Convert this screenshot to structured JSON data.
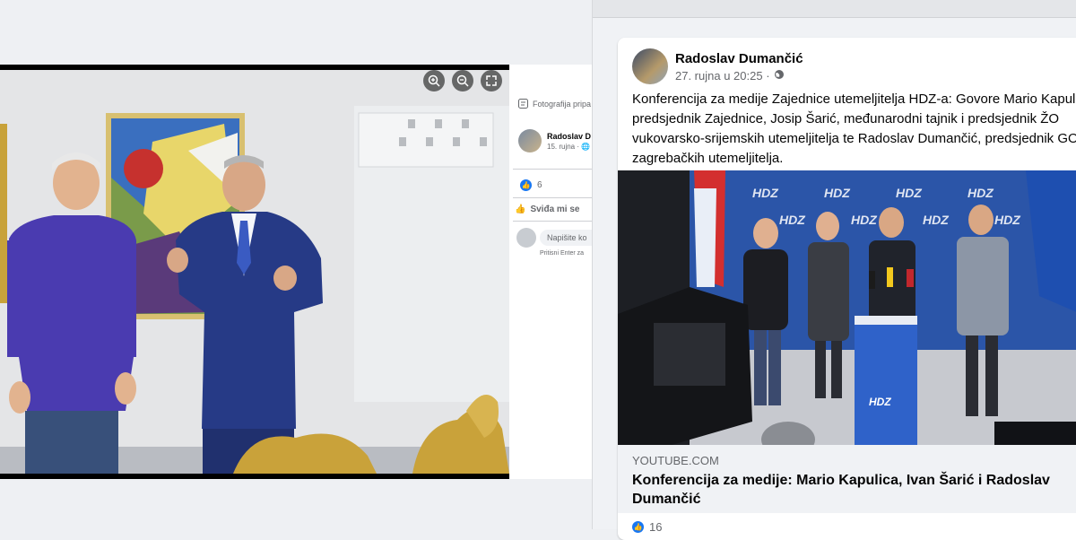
{
  "viewer": {
    "zoom_in_icon": "zoom-in-icon",
    "zoom_out_icon": "zoom-out-icon",
    "fullscreen_icon": "expand-icon"
  },
  "side_panel": {
    "caption": "Fotografija pripa",
    "author": "Radoslav D",
    "date": "15. rujna · ",
    "likes": "6",
    "like_action": "Sviđa mi se",
    "comment_placeholder": "Napišite ko",
    "comment_hint": "Pritisni Enter za"
  },
  "post": {
    "author": "Radoslav Dumančić",
    "date": "27. rujna u 20:25 · ",
    "text": "Konferencija za medije Zajednice utemeljitelja HDZ-a: Govore Mario Kapulica, predsjednik Zajednice, Josip Šarić, međunarodni tajnik i predsjednik ŽO vukovarsko-srijemskih utemeljitelja te Radoslav Dumančić, predsjednik GO zagrebačkih utemeljitelja.",
    "banner_text": "HDZ",
    "podium_text": "HDZ",
    "link_domain": "YOUTUBE.COM",
    "link_title": "Konferencija za medije: Mario Kapulica, Ivan Šarić i Radoslav Dumančić",
    "footer_count": "16"
  },
  "colors": {
    "facebook_blue": "#1877f2",
    "hdz_blue": "#1f4fa0",
    "text_primary": "#050505",
    "text_secondary": "#65676b"
  }
}
